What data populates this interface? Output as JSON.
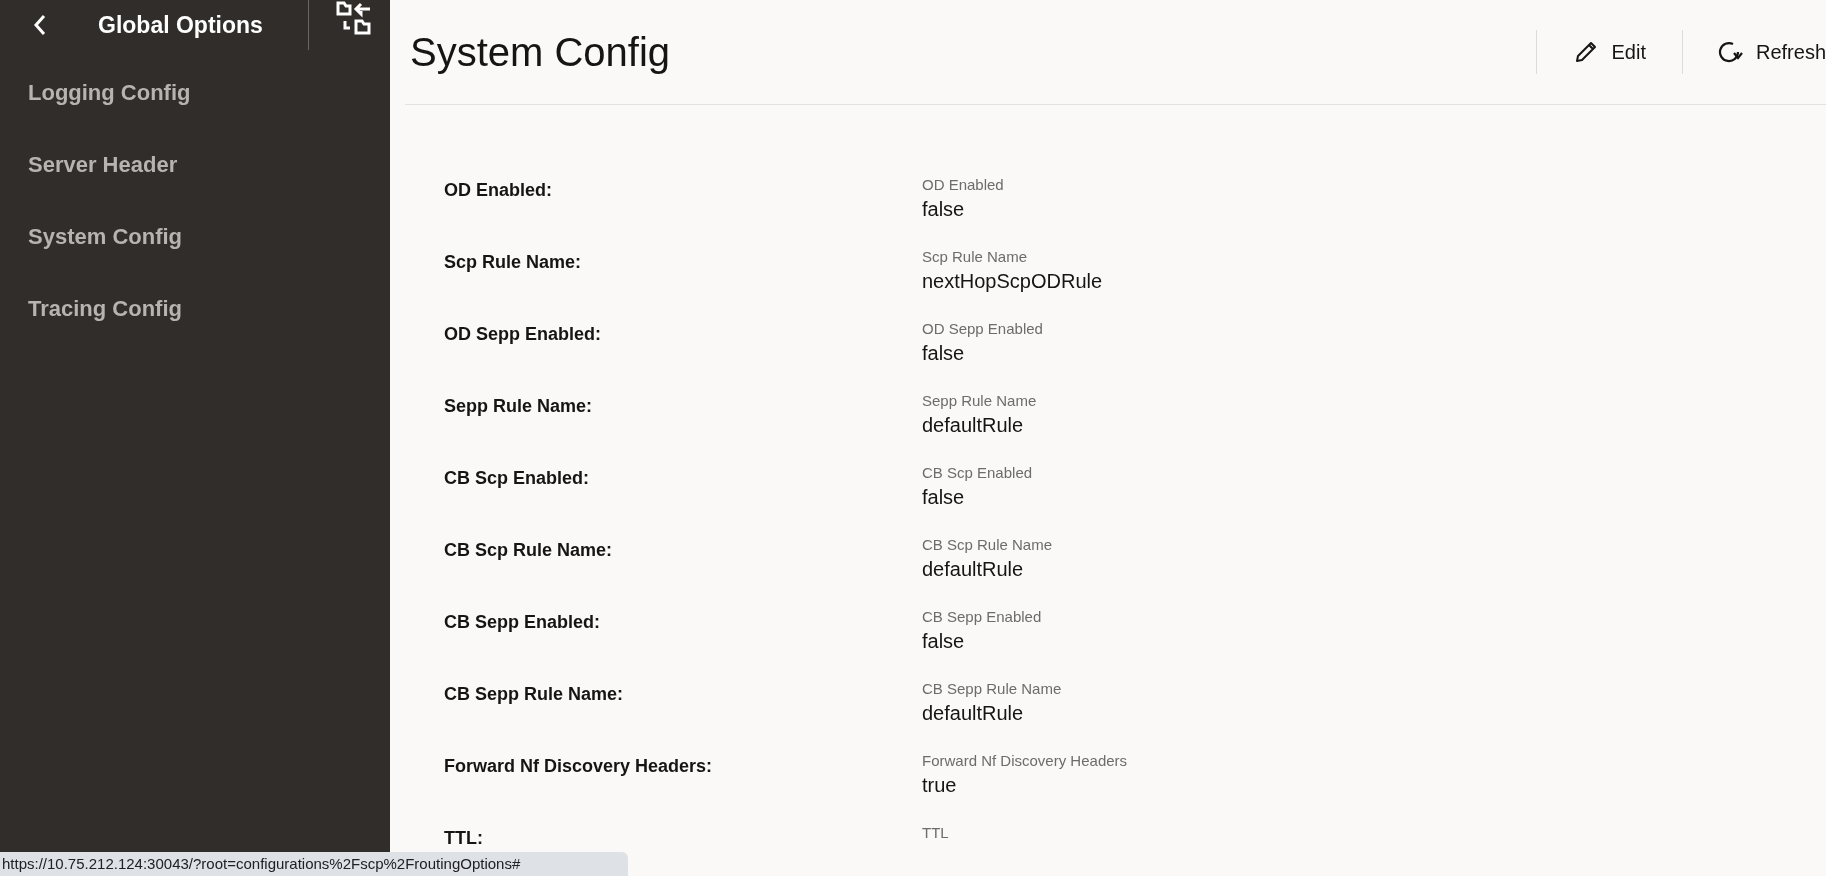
{
  "sidebar": {
    "title": "Global Options",
    "items": [
      {
        "label": "Logging Config",
        "selected": false
      },
      {
        "label": "Server Header",
        "selected": false
      },
      {
        "label": "System Config",
        "selected": false
      },
      {
        "label": "Tracing Config",
        "selected": false
      }
    ]
  },
  "header": {
    "title": "System Config",
    "actions": [
      {
        "kind": "edit",
        "label": "Edit"
      },
      {
        "kind": "refresh",
        "label": "Refresh"
      }
    ]
  },
  "fields": [
    {
      "label": "OD Enabled:",
      "caption": "OD Enabled",
      "value": "false"
    },
    {
      "label": "Scp Rule Name:",
      "caption": "Scp Rule Name",
      "value": "nextHopScpODRule"
    },
    {
      "label": "OD Sepp Enabled:",
      "caption": "OD Sepp Enabled",
      "value": "false"
    },
    {
      "label": "Sepp Rule Name:",
      "caption": "Sepp Rule Name",
      "value": "defaultRule"
    },
    {
      "label": "CB Scp Enabled:",
      "caption": "CB Scp Enabled",
      "value": "false"
    },
    {
      "label": "CB Scp Rule Name:",
      "caption": "CB Scp Rule Name",
      "value": "defaultRule"
    },
    {
      "label": "CB Sepp Enabled:",
      "caption": "CB Sepp Enabled",
      "value": "false"
    },
    {
      "label": "CB Sepp Rule Name:",
      "caption": "CB Sepp Rule Name",
      "value": "defaultRule"
    },
    {
      "label": "Forward Nf Discovery Headers:",
      "caption": "Forward Nf Discovery Headers",
      "value": "true"
    },
    {
      "label": "TTL:",
      "caption": "TTL"
    }
  ],
  "status_bar": {
    "url": "https://10.75.212.124:30043/?root=configurations%2Fscp%2FroutingOptions#"
  }
}
